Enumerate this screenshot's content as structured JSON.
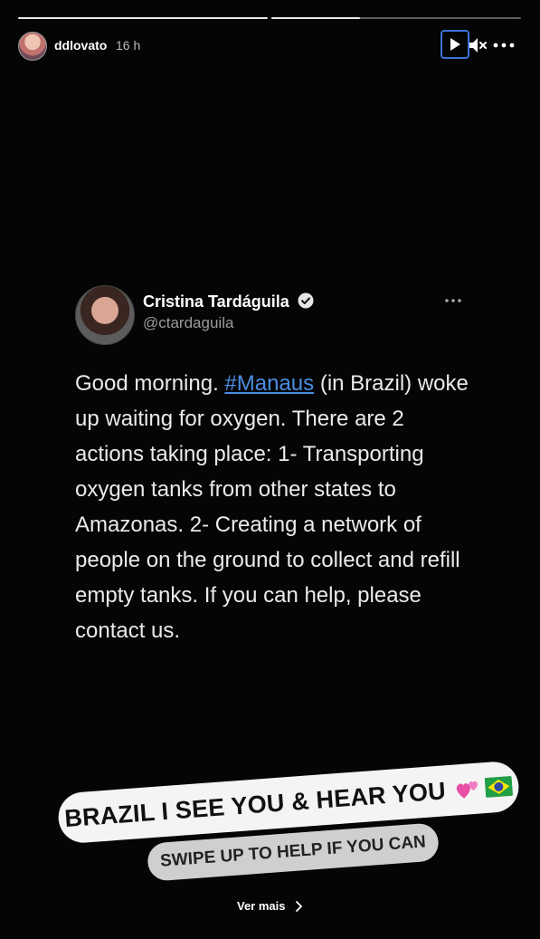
{
  "header": {
    "username": "ddlovato",
    "time_ago": "16 h",
    "progress": [
      1.0,
      0.36
    ]
  },
  "tweet": {
    "author_name": "Cristina Tardáguila",
    "handle": "@ctardaguila",
    "text_before": "Good morning. ",
    "hashtag": "#Manaus",
    "text_after": " (in Brazil) woke up waiting for oxygen. There are 2 actions taking place: 1- Transporting oxygen tanks from other states to Amazonas. 2- Creating a network of people on the ground to collect and refill empty tanks. If you can help, please contact us."
  },
  "stickers": {
    "primary": "BRAZIL I SEE YOU & HEAR YOU",
    "secondary": "SWIPE UP TO HELP IF YOU CAN"
  },
  "footer": {
    "see_more": "Ver mais"
  },
  "icons": {
    "play": "play-icon",
    "mute": "speaker-muted-icon",
    "more": "more-horizontal-icon",
    "verified": "verified-badge-icon"
  },
  "colors": {
    "accent_focus": "#3b73d6",
    "hashtag": "#4a8de0",
    "background": "#050505"
  }
}
